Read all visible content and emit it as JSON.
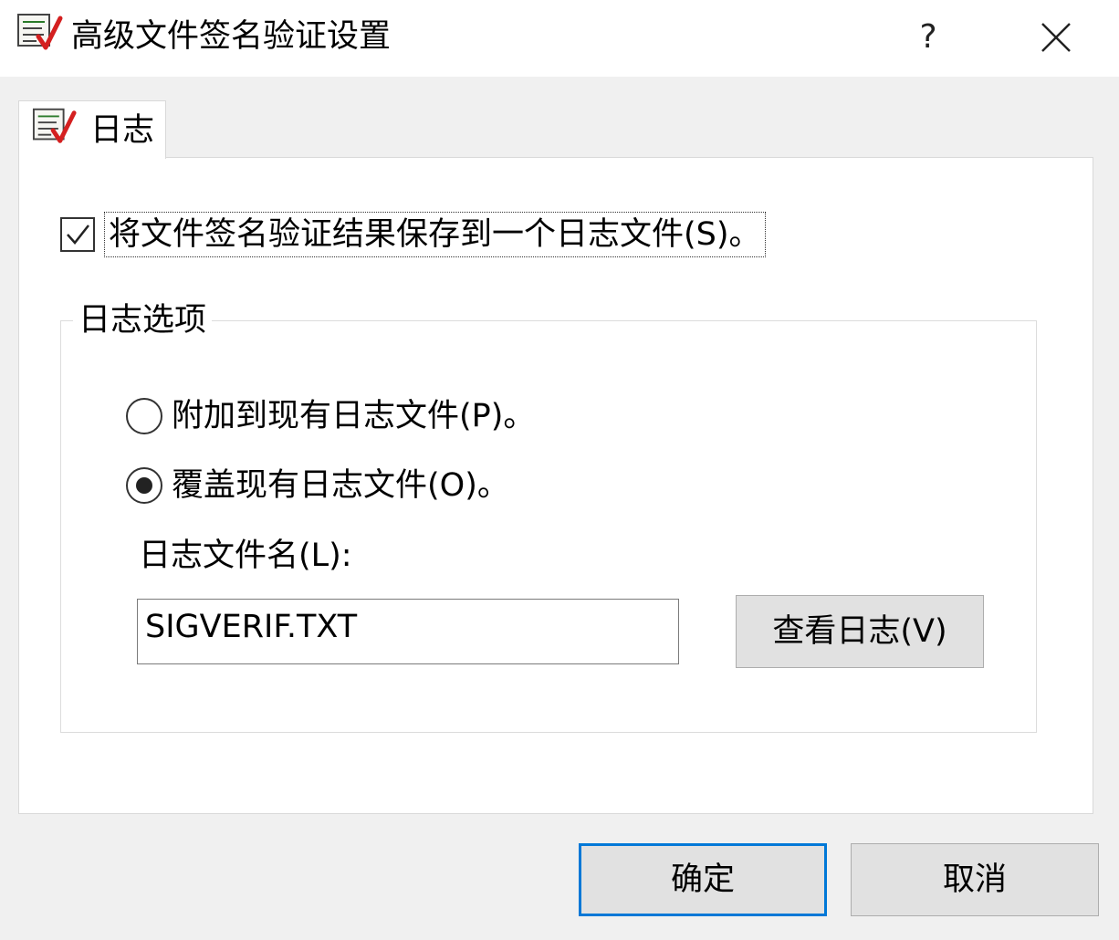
{
  "window": {
    "title": "高级文件签名验证设置",
    "help_symbol": "?",
    "icon": "document-check-icon"
  },
  "tabs": [
    {
      "label": "日志",
      "icon": "document-check-icon",
      "selected": true
    }
  ],
  "save_log": {
    "label": "将文件签名验证结果保存到一个日志文件(S)。",
    "checked": true
  },
  "log_options": {
    "legend": "日志选项",
    "append_label": "附加到现有日志文件(P)。",
    "append_selected": false,
    "overwrite_label": "覆盖现有日志文件(O)。",
    "overwrite_selected": true,
    "filename_label": "日志文件名(L):",
    "filename_value": "SIGVERIF.TXT",
    "view_log_label": "查看日志(V)"
  },
  "buttons": {
    "ok_label": "确定",
    "cancel_label": "取消"
  },
  "colors": {
    "default_button_border": "#0078d7",
    "check_mark_red": "#d42020"
  }
}
